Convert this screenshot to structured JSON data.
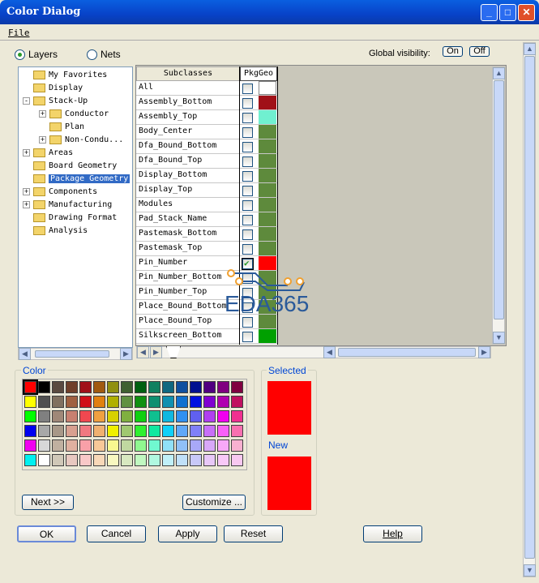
{
  "window": {
    "title": "Color Dialog",
    "menu": [
      "File"
    ]
  },
  "mode": {
    "layers": "Layers",
    "nets": "Nets",
    "selected": "Layers"
  },
  "global_visibility": {
    "label": "Global visibility:",
    "on": "On",
    "off": "Off"
  },
  "tree": [
    {
      "label": "My Favorites",
      "level": 1,
      "expander": ""
    },
    {
      "label": "Display",
      "level": 1,
      "expander": ""
    },
    {
      "label": "Stack-Up",
      "level": 1,
      "expander": "-"
    },
    {
      "label": "Conductor",
      "level": 2,
      "expander": "+"
    },
    {
      "label": "Plan",
      "level": 2,
      "expander": ""
    },
    {
      "label": "Non-Condu...",
      "level": 2,
      "expander": "+"
    },
    {
      "label": "Areas",
      "level": 1,
      "expander": "+"
    },
    {
      "label": "Board Geometry",
      "level": 1,
      "expander": ""
    },
    {
      "label": "Package Geometry",
      "level": 1,
      "expander": "",
      "selected": true
    },
    {
      "label": "Components",
      "level": 1,
      "expander": "+"
    },
    {
      "label": "Manufacturing",
      "level": 1,
      "expander": "+"
    },
    {
      "label": "Drawing Format",
      "level": 1,
      "expander": ""
    },
    {
      "label": "Analysis",
      "level": 1,
      "expander": ""
    }
  ],
  "table": {
    "headers": [
      "Subclasses",
      "PkgGeo"
    ],
    "rows": [
      {
        "name": "All",
        "checked": false,
        "color": "#ffffff"
      },
      {
        "name": "Assembly_Bottom",
        "checked": false,
        "color": "#a01018"
      },
      {
        "name": "Assembly_Top",
        "checked": false,
        "color": "#70f0d0"
      },
      {
        "name": "Body_Center",
        "checked": false,
        "color": "#5e8a3c"
      },
      {
        "name": "Dfa_Bound_Bottom",
        "checked": false,
        "color": "#5e8a3c"
      },
      {
        "name": "Dfa_Bound_Top",
        "checked": false,
        "color": "#5e8a3c"
      },
      {
        "name": "Display_Bottom",
        "checked": false,
        "color": "#5e8a3c"
      },
      {
        "name": "Display_Top",
        "checked": false,
        "color": "#5e8a3c"
      },
      {
        "name": "Modules",
        "checked": false,
        "color": "#5e8a3c"
      },
      {
        "name": "Pad_Stack_Name",
        "checked": false,
        "color": "#5e8a3c"
      },
      {
        "name": "Pastemask_Bottom",
        "checked": false,
        "color": "#5e8a3c"
      },
      {
        "name": "Pastemask_Top",
        "checked": false,
        "color": "#5e8a3c"
      },
      {
        "name": "Pin_Number",
        "checked": true,
        "color": "#ff0000"
      },
      {
        "name": "Pin_Number_Bottom",
        "checked": false,
        "color": "#5e8a3c"
      },
      {
        "name": "Pin_Number_Top",
        "checked": false,
        "color": "#5e8a3c"
      },
      {
        "name": "Place_Bound_Bottom",
        "checked": false,
        "color": "#5e8a3c"
      },
      {
        "name": "Place_Bound_Top",
        "checked": false,
        "color": "#5e8a3c"
      },
      {
        "name": "Silkscreen_Bottom",
        "checked": false,
        "color": "#00a000"
      }
    ]
  },
  "watermark": "EDA365",
  "color_group": {
    "label": "Color",
    "next": "Next >>",
    "customize": "Customize ...",
    "palette": [
      [
        "#ff0000",
        "#000000",
        "#5a4a40",
        "#70402a",
        "#a01018",
        "#a05a10",
        "#909010",
        "#406030",
        "#006010",
        "#108060",
        "#106880",
        "#1050a0",
        "#001090",
        "#500080",
        "#800080",
        "#800040"
      ],
      [
        "#ffff00",
        "#505050",
        "#807060",
        "#a06040",
        "#d01018",
        "#e08010",
        "#b0b000",
        "#609040",
        "#109010",
        "#109070",
        "#1090b0",
        "#1070d0",
        "#0010e0",
        "#8000d0",
        "#b000b0",
        "#c01060"
      ],
      [
        "#00ff00",
        "#808080",
        "#a08878",
        "#c88070",
        "#f04850",
        "#f0a040",
        "#d8d000",
        "#80b040",
        "#10d010",
        "#10c090",
        "#10b8e0",
        "#3090f0",
        "#6060f0",
        "#b040f0",
        "#f000f0",
        "#f03090"
      ],
      [
        "#0000f0",
        "#a8a8a8",
        "#a89888",
        "#d8a090",
        "#f07880",
        "#f0b070",
        "#f0f000",
        "#a0c870",
        "#30f030",
        "#10e8a0",
        "#10d0f8",
        "#60a8f8",
        "#8080f8",
        "#c870f8",
        "#f860f8",
        "#f870b0"
      ],
      [
        "#f000f0",
        "#d8d8d8",
        "#c0b0a0",
        "#e0b0a0",
        "#f8a0a8",
        "#f8c898",
        "#f8f890",
        "#c0d8a0",
        "#90f890",
        "#70f8d0",
        "#90e0f8",
        "#90c0f8",
        "#a8a8f8",
        "#d8a8f8",
        "#f8a8f8",
        "#f8b0d0"
      ],
      [
        "#00f0f0",
        "#ffffff",
        "#d0c8b8",
        "#e8c8c0",
        "#f8c8c8",
        "#f8d8b8",
        "#f8f8c0",
        "#d8e8c0",
        "#c0f8c0",
        "#b0f8e0",
        "#c0f0f8",
        "#c0e0f8",
        "#c8c8f8",
        "#e8c8f8",
        "#f8c8f8",
        "#f8c8f0"
      ]
    ]
  },
  "preview": {
    "selected_label": "Selected",
    "new_label": "New",
    "selected_color": "#ff0000",
    "new_color": "#ff0000"
  },
  "buttons": {
    "ok": "OK",
    "cancel": "Cancel",
    "apply": "Apply",
    "reset": "Reset",
    "help": "Help"
  }
}
